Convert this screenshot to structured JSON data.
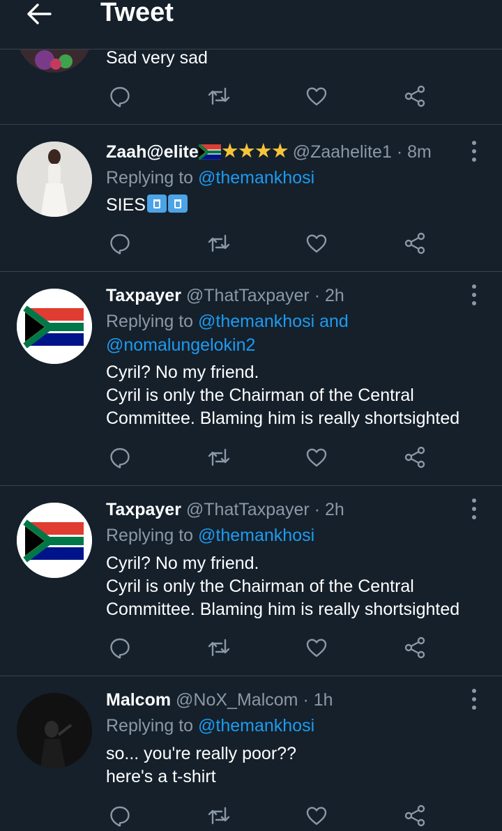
{
  "header": {
    "title": "Tweet"
  },
  "tweets": [
    {
      "text_lines": [
        "Sad very sad"
      ]
    },
    {
      "name": "Zaah@elite",
      "name_suffix_stars": "★★★★",
      "handle": "@Zaahelite1",
      "time": "· 8m",
      "replying_prefix": "Replying to",
      "replying_to": "@themankhosi",
      "replying_extra": "",
      "text_lines": [
        "SIES"
      ]
    },
    {
      "name": "Taxpayer",
      "handle": "@ThatTaxpayer",
      "time": "· 2h",
      "replying_prefix": "Replying to",
      "replying_to": "@themankhosi and",
      "replying_extra": "@nomalungelokin2",
      "text_lines": [
        "Cyril? No my friend.",
        "Cyril is only the Chairman of the Central",
        "Committee. Blaming him is really shortsighted"
      ]
    },
    {
      "name": "Taxpayer",
      "handle": "@ThatTaxpayer",
      "time": "· 2h",
      "replying_prefix": "Replying to",
      "replying_to": "@themankhosi",
      "text_lines": [
        "Cyril? No my friend.",
        "Cyril is only the Chairman of the Central",
        "Committee. Blaming him is really shortsighted"
      ]
    },
    {
      "name": "Malcom",
      "handle": "@NoX_Malcom",
      "time": "· 1h",
      "replying_prefix": "Replying to",
      "replying_to": "@themankhosi",
      "text_lines": [
        "so... you're really poor??",
        "here's a t-shirt"
      ]
    }
  ],
  "icons": {
    "back": "arrow-left-icon",
    "reply": "reply-icon",
    "retweet": "retweet-icon",
    "like": "heart-icon",
    "share": "share-icon",
    "more": "more-vertical-icon"
  },
  "colors": {
    "background": "#15202b",
    "divider": "#38444d",
    "text": "#ffffff",
    "secondary": "#8b98a5",
    "link": "#1d9bf0",
    "star": "#f6c33b"
  }
}
